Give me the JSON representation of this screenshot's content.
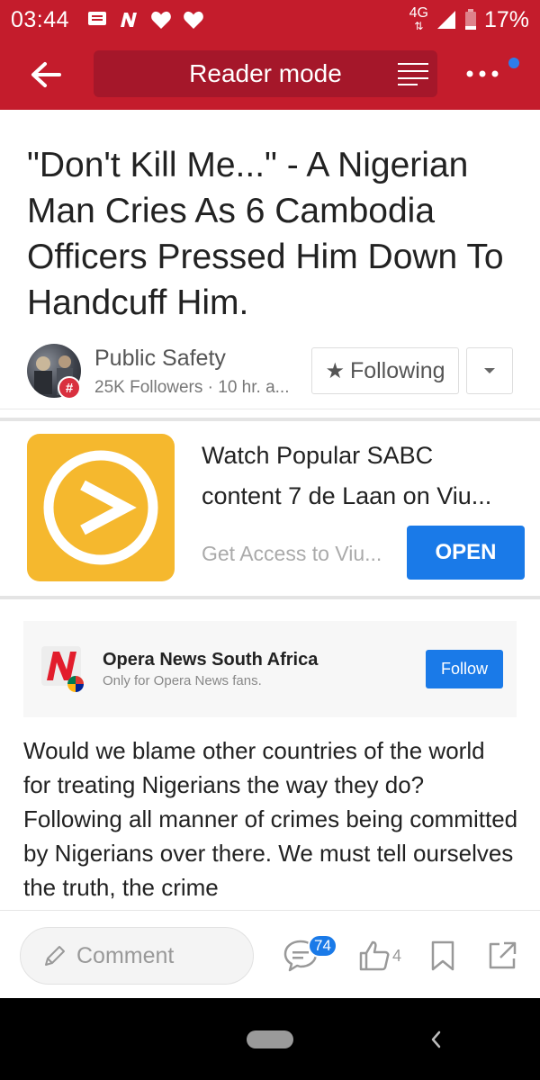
{
  "status_bar": {
    "time": "03:44",
    "network": "4G",
    "battery": "17%",
    "icons": [
      "message-icon",
      "n-app-icon",
      "heart-icon",
      "heart-icon"
    ]
  },
  "app_bar": {
    "back_icon": "arrow-left-icon",
    "mode_label": "Reader mode",
    "reader_icon": "lines-icon",
    "more_icon": "more-dots-icon",
    "accent": "#c41c2c"
  },
  "article": {
    "headline": "\"Don't Kill Me...\" - A Nigerian Man Cries As 6 Cambodia Officers Pressed Him Down To Handcuff Him.",
    "source": {
      "name": "Public Safety",
      "meta": "25K Followers · 10 hr. a...",
      "badge": "#",
      "following_label": "Following"
    },
    "body": "Would we blame other countries of the world for treating Nigerians the way they do? Following all manner of crimes being committed by Nigerians over there. We must tell ourselves the truth, the crime"
  },
  "ad": {
    "title_line1": "Watch Popular SABC",
    "title_line2": "content 7 de Laan on Viu...",
    "subtitle": "Get Access to Viu...",
    "button": "OPEN",
    "icon_color": "#f5b82e"
  },
  "opera_card": {
    "name": "Opera News South Africa",
    "subtitle": "Only for Opera News fans.",
    "button": "Follow"
  },
  "bottom_bar": {
    "comment_placeholder": "Comment",
    "comment_count": "74",
    "like_count": "4"
  }
}
